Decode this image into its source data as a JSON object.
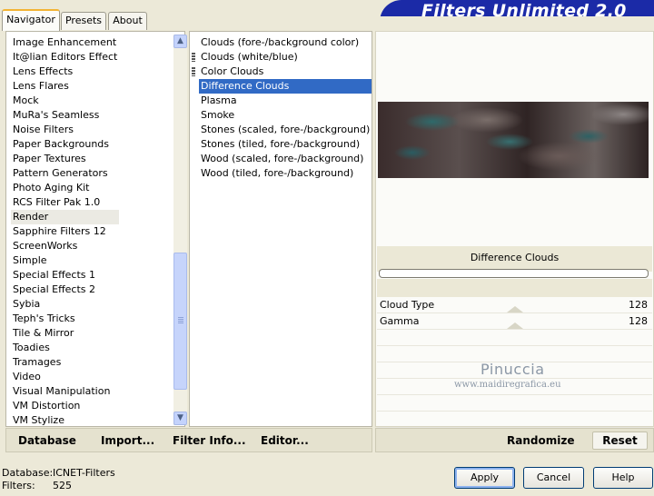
{
  "tabs": [
    "Navigator",
    "Presets",
    "About"
  ],
  "brand": "Filters Unlimited 2.0",
  "categories": [
    "Image Enhancement",
    "It@lian Editors Effect",
    "Lens Effects",
    "Lens Flares",
    "Mock",
    "MuRa's Seamless",
    "Noise Filters",
    "Paper Backgrounds",
    "Paper Textures",
    "Pattern Generators",
    "Photo Aging Kit",
    "RCS Filter Pak 1.0",
    "Render",
    "Sapphire Filters 12",
    "ScreenWorks",
    "Simple",
    "Special Effects 1",
    "Special Effects 2",
    "Sybia",
    "Teph's Tricks",
    "Tile & Mirror",
    "Toadies",
    "Tramages",
    "Video",
    "Visual Manipulation",
    "VM Distortion",
    "VM Stylize"
  ],
  "filters": [
    "Clouds (fore-/background color)",
    "Clouds (white/blue)",
    "Color Clouds",
    "Difference Clouds",
    "Plasma",
    "Smoke",
    "Stones (scaled, fore-/background)",
    "Stones (tiled, fore-/background)",
    "Wood (scaled, fore-/background)",
    "Wood (tiled, fore-/background)"
  ],
  "selected_filter": "Difference Clouds",
  "params": [
    {
      "label": "Cloud Type",
      "value": "128"
    },
    {
      "label": "Gamma",
      "value": "128"
    }
  ],
  "watermark": {
    "name": "Pinuccia",
    "site": "www.maidiregrafica.eu"
  },
  "toolbar": {
    "database": "Database",
    "import": "Import...",
    "filter_info": "Filter Info...",
    "editor": "Editor...",
    "randomize": "Randomize",
    "reset": "Reset"
  },
  "footer": {
    "database_label": "Database:",
    "database_value": "ICNET-Filters",
    "filters_label": "Filters:",
    "filters_value": "525"
  },
  "buttons": {
    "apply": "Apply",
    "cancel": "Cancel",
    "help": "Help"
  }
}
